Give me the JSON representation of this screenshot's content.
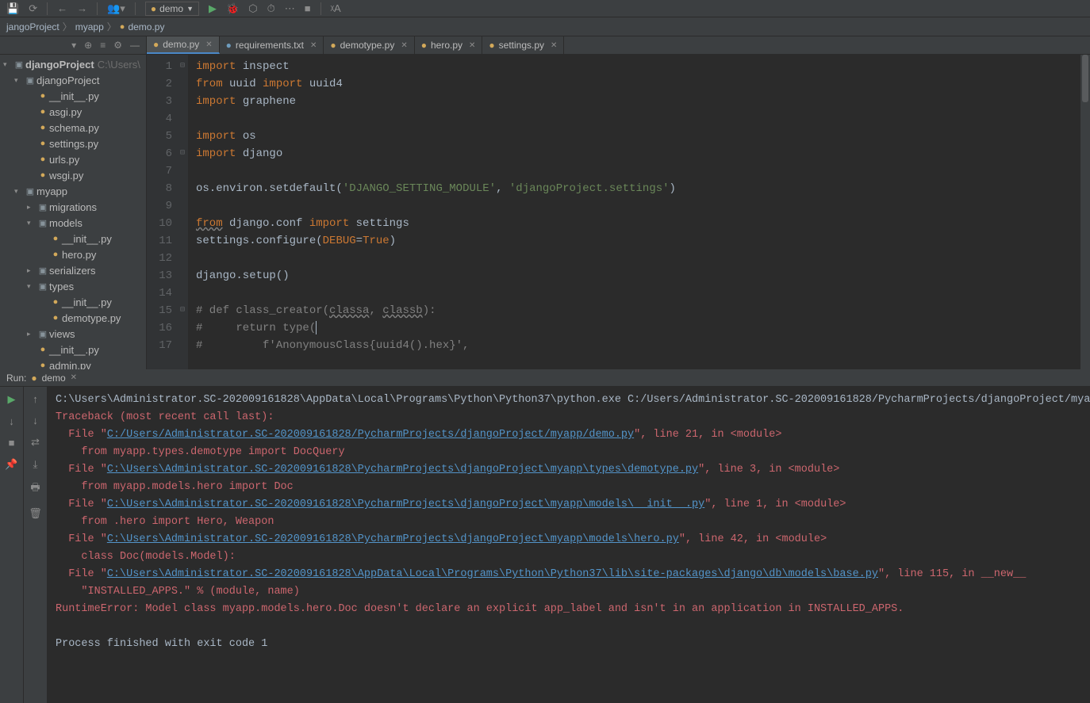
{
  "toolbar": {
    "config_name": "demo"
  },
  "breadcrumb": {
    "items": [
      "jangoProject",
      "myapp",
      "demo.py"
    ]
  },
  "project_tree": {
    "root": {
      "name": "djangoProject",
      "hint": "C:\\Users\\"
    },
    "items": [
      {
        "depth": 1,
        "arrow": "down",
        "icon": "folder",
        "label": "djangoProject"
      },
      {
        "depth": 2,
        "arrow": "",
        "icon": "py",
        "label": "__init__.py"
      },
      {
        "depth": 2,
        "arrow": "",
        "icon": "py",
        "label": "asgi.py"
      },
      {
        "depth": 2,
        "arrow": "",
        "icon": "py",
        "label": "schema.py"
      },
      {
        "depth": 2,
        "arrow": "",
        "icon": "py",
        "label": "settings.py"
      },
      {
        "depth": 2,
        "arrow": "",
        "icon": "py",
        "label": "urls.py"
      },
      {
        "depth": 2,
        "arrow": "",
        "icon": "py",
        "label": "wsgi.py"
      },
      {
        "depth": 1,
        "arrow": "down",
        "icon": "folder",
        "label": "myapp"
      },
      {
        "depth": 2,
        "arrow": "right",
        "icon": "folder",
        "label": "migrations"
      },
      {
        "depth": 2,
        "arrow": "down",
        "icon": "folder",
        "label": "models"
      },
      {
        "depth": 3,
        "arrow": "",
        "icon": "py",
        "label": "__init__.py"
      },
      {
        "depth": 3,
        "arrow": "",
        "icon": "py",
        "label": "hero.py"
      },
      {
        "depth": 2,
        "arrow": "right",
        "icon": "folder",
        "label": "serializers"
      },
      {
        "depth": 2,
        "arrow": "down",
        "icon": "folder",
        "label": "types"
      },
      {
        "depth": 3,
        "arrow": "",
        "icon": "py",
        "label": "__init__.py"
      },
      {
        "depth": 3,
        "arrow": "",
        "icon": "py",
        "label": "demotype.py"
      },
      {
        "depth": 2,
        "arrow": "right",
        "icon": "folder",
        "label": "views"
      },
      {
        "depth": 2,
        "arrow": "",
        "icon": "py",
        "label": "__init__.py"
      },
      {
        "depth": 2,
        "arrow": "",
        "icon": "py",
        "label": "admin.py"
      }
    ]
  },
  "tabs": [
    {
      "label": "demo.py",
      "icon": "py",
      "active": true
    },
    {
      "label": "requirements.txt",
      "icon": "txt",
      "active": false
    },
    {
      "label": "demotype.py",
      "icon": "py",
      "active": false
    },
    {
      "label": "hero.py",
      "icon": "py",
      "active": false
    },
    {
      "label": "settings.py",
      "icon": "py",
      "active": false
    }
  ],
  "code": {
    "lines": [
      {
        "n": 1,
        "html": "<span class='kw'>import</span> <span class='ident'>inspect</span>"
      },
      {
        "n": 2,
        "html": "<span class='kw'>from</span> uuid <span class='kw'>import</span> uuid4"
      },
      {
        "n": 3,
        "html": "<span class='kw'>import</span> graphene"
      },
      {
        "n": 4,
        "html": ""
      },
      {
        "n": 5,
        "html": "<span class='kw'>import</span> os"
      },
      {
        "n": 6,
        "html": "<span class='kw'>import</span> django"
      },
      {
        "n": 7,
        "html": ""
      },
      {
        "n": 8,
        "html": "os.environ.setdefault(<span class='str'>'DJANGO_SETTING_MODULE'</span>, <span class='str'>'djangoProject.settings'</span>)"
      },
      {
        "n": 9,
        "html": ""
      },
      {
        "n": 10,
        "html": "<span class='kw und'>from</span> django.conf <span class='kw'>import</span> settings"
      },
      {
        "n": 11,
        "html": "settings.configure(<span style='color:#cc7832'>DEBUG</span>=<span class='bool'>True</span>)"
      },
      {
        "n": 12,
        "html": ""
      },
      {
        "n": 13,
        "html": "django.setup()"
      },
      {
        "n": 14,
        "html": ""
      },
      {
        "n": 15,
        "html": "<span class='cmt'># def class_creator(<span class='und'>classa</span>, <span class='und'>classb</span>):</span>"
      },
      {
        "n": 16,
        "html": "<span class='cmt'>#     return type(<span class='caret'></span></span>"
      },
      {
        "n": 17,
        "html": "<span class='cmt'>#         f'AnonymousClass{uuid4().hex}',</span>"
      }
    ]
  },
  "run": {
    "label": "Run:",
    "config": "demo",
    "output_html": "<span>C:\\Users\\Administrator.SC-202009161828\\AppData\\Local\\Programs\\Python\\Python37\\python.exe C:/Users/Administrator.SC-202009161828/PycharmProjects/djangoProject/myapp/</span>\n<span class='err'>Traceback (most recent call last):</span>\n<span class='err'>  File \"</span><span class='link'>C:/Users/Administrator.SC-202009161828/PycharmProjects/djangoProject/myapp/demo.py</span><span class='err'>\", line 21, in &lt;module&gt;</span>\n<span class='err'>    from myapp.types.demotype import DocQuery</span>\n<span class='err'>  File \"</span><span class='link'>C:\\Users\\Administrator.SC-202009161828\\PycharmProjects\\djangoProject\\myapp\\types\\demotype.py</span><span class='err'>\", line 3, in &lt;module&gt;</span>\n<span class='err'>    from myapp.models.hero import Doc</span>\n<span class='err'>  File \"</span><span class='link'>C:\\Users\\Administrator.SC-202009161828\\PycharmProjects\\djangoProject\\myapp\\models\\__init__.py</span><span class='err'>\", line 1, in &lt;module&gt;</span>\n<span class='err'>    from .hero import Hero, Weapon</span>\n<span class='err'>  File \"</span><span class='link'>C:\\Users\\Administrator.SC-202009161828\\PycharmProjects\\djangoProject\\myapp\\models\\hero.py</span><span class='err'>\", line 42, in &lt;module&gt;</span>\n<span class='err'>    class Doc(models.Model):</span>\n<span class='err'>  File \"</span><span class='link'>C:\\Users\\Administrator.SC-202009161828\\AppData\\Local\\Programs\\Python\\Python37\\lib\\site-packages\\django\\db\\models\\base.py</span><span class='err'>\", line 115, in __new__</span>\n<span class='err'>    \"INSTALLED_APPS.\" % (module, name)</span>\n<span class='err'>RuntimeError: Model class myapp.models.hero.Doc doesn't declare an explicit app_label and isn't in an application in INSTALLED_APPS.</span>\n\n<span>Process finished with exit code 1</span>"
  }
}
